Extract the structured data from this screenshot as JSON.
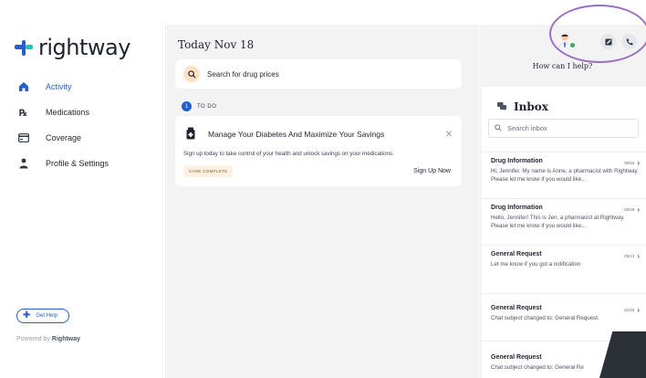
{
  "app": {
    "logo_text": "rightway",
    "powered_prefix": "Powered by",
    "powered_brand": "Rightway",
    "colors": {
      "brand_blue": "#1f5fd6",
      "brand_teal": "#16c5c0",
      "accent_highlight": "#9b6fc4"
    }
  },
  "sidebar": {
    "items": [
      {
        "label": "Activity",
        "icon": "home-icon",
        "active": true
      },
      {
        "label": "Medications",
        "icon": "rx-icon",
        "active": false
      },
      {
        "label": "Coverage",
        "icon": "card-icon",
        "active": false
      },
      {
        "label": "Profile & Settings",
        "icon": "person-icon",
        "active": false
      }
    ],
    "get_help_label": "Get Help"
  },
  "main": {
    "date_title": "Today Nov 18",
    "search_label": "Search for drug prices",
    "todo_count": "1",
    "todo_label": "TO DO",
    "task": {
      "title": "Manage Your Diabetes And Maximize Your Savings",
      "description": "Sign up today to take control of your health and unlock savings on your medications.",
      "badge": "CARE COMPLETE",
      "cta": "Sign Up Now"
    }
  },
  "right": {
    "how_help": "How can I help?",
    "inbox_title": "Inbox",
    "inbox_search_placeholder": "Search inbox",
    "messages": [
      {
        "title": "Drug Information",
        "date": "09/16",
        "body": "Hi, Jennifer. My name is Anne, a pharmacist with Rightway. Please let me know if you would like..."
      },
      {
        "title": "Drug Information",
        "date": "06/18",
        "body": "Hello, Jennifer! This is Jen, a pharmacist at Rightway. Please let me know if you would like..."
      },
      {
        "title": "General Request",
        "date": "05/13",
        "body": "Let me know if you got a notification"
      },
      {
        "title": "General Request",
        "date": "02/15",
        "body": "Chat subject changed to: General Request."
      },
      {
        "title": "General Request",
        "date": "",
        "body": "Chat subject changed to: General Re"
      }
    ]
  }
}
